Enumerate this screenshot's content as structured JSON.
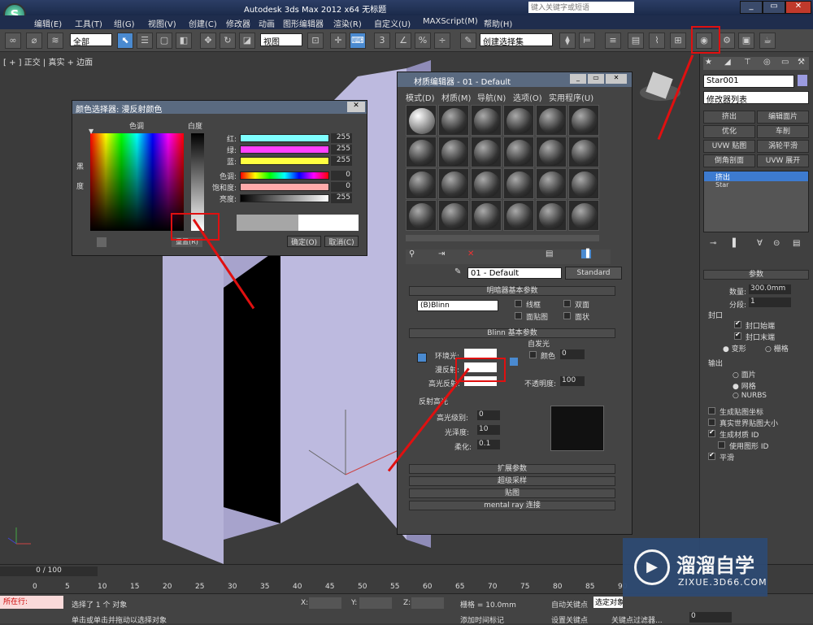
{
  "app": {
    "title": "Autodesk 3ds Max  2012 x64      无标题",
    "search_placeholder": "键入关键字或短语"
  },
  "menu": [
    "编辑(E)",
    "工具(T)",
    "组(G)",
    "视图(V)",
    "创建(C)",
    "修改器",
    "动画",
    "图形编辑器",
    "渲染(R)",
    "自定义(U)",
    "MAXScript(M)",
    "帮助(H)"
  ],
  "toolbar": {
    "filter": "全部",
    "view": "视图",
    "selection_set": "创建选择集"
  },
  "viewport": {
    "label": "[ + ] 正交 | 真实 + 边面"
  },
  "right_panel": {
    "object_name": "Star001",
    "modifier_list": "修改器列表",
    "buttons": [
      "挤出",
      "编辑面片",
      "优化",
      "车削",
      "UVW 贴图",
      "涡轮平滑",
      "倒角剖面",
      "UVW 展开"
    ],
    "stack": [
      "挤出",
      "Star"
    ],
    "params_title": "参数",
    "amount_label": "数量:",
    "amount_value": "300.0mm",
    "segments_label": "分段:",
    "segments_value": "1",
    "capping_title": "封口",
    "cap_start": "封口始端",
    "cap_end": "封口末端",
    "morph": "变形",
    "grid": "栅格",
    "output_title": "输出",
    "out_patch": "面片",
    "out_mesh": "网格",
    "out_nurbs": "NURBS",
    "gen_coords": "生成贴图坐标",
    "real_world": "真实世界贴图大小",
    "gen_mat_id": "生成材质 ID",
    "use_shape_id": "使用图形 ID",
    "smooth": "平滑"
  },
  "color_dialog": {
    "title": "颜色选择器: 漫反射颜色",
    "hue_label": "色调",
    "whiteness_label": "白度",
    "blackness_label": "黑度",
    "rows": [
      {
        "label": "红:",
        "value": "255",
        "color": "#7fffff"
      },
      {
        "label": "绿:",
        "value": "255",
        "color": "#ff40ff"
      },
      {
        "label": "蓝:",
        "value": "255",
        "color": "#ffff40"
      },
      {
        "label": "色调:",
        "value": "0",
        "color": "#ff0000"
      },
      {
        "label": "饱和度:",
        "value": "0",
        "color": "#ffaaaa"
      },
      {
        "label": "亮度:",
        "value": "255",
        "color": "#ffffff"
      }
    ],
    "reset": "重置(R)",
    "ok": "确定(O)",
    "cancel": "取消(C)"
  },
  "material_editor": {
    "title": "材质编辑器 - 01 - Default",
    "menu": [
      "模式(D)",
      "材质(M)",
      "导航(N)",
      "选项(O)",
      "实用程序(U)"
    ],
    "mat_name": "01 - Default",
    "mat_type": "Standard",
    "shader_title": "明暗器基本参数",
    "shader": "(B)Blinn",
    "wire": "线框",
    "two_sided": "双面",
    "face_map": "面贴图",
    "faceted": "面状",
    "blinn_title": "Blinn 基本参数",
    "self_illum": "自发光",
    "color": "颜色",
    "self_illum_value": "0",
    "ambient": "环境光:",
    "diffuse": "漫反射:",
    "specular": "高光反射:",
    "opacity": "不透明度:",
    "opacity_value": "100",
    "spec_title": "反射高光",
    "spec_level": "高光级别:",
    "spec_level_value": "0",
    "gloss": "光泽度:",
    "gloss_value": "10",
    "soften": "柔化:",
    "soften_value": "0.1",
    "rollouts": [
      "扩展参数",
      "超级采样",
      "贴图",
      "mental ray 连接"
    ]
  },
  "timeline": {
    "frame": "0 / 100",
    "ticks": [
      "0",
      "5",
      "10",
      "15",
      "20",
      "25",
      "30",
      "35",
      "40",
      "45",
      "50",
      "55",
      "60",
      "65",
      "70",
      "75",
      "80",
      "85",
      "90"
    ]
  },
  "status": {
    "selected": "选择了 1 个 对象",
    "hint": "单击或单击并拖动以选择对象",
    "in_progress": "所在行:",
    "grid": "栅格 = 10.0mm",
    "auto_key": "自动关键点",
    "set_key": "设置关键点",
    "selected_obj": "选定对象",
    "key_filter": "关键点过滤器...",
    "add_time_tag": "添加时间标记",
    "frame_value": "0",
    "x": "X:",
    "y": "Y:",
    "z": "Z:"
  },
  "watermark": {
    "brand": "溜溜自学",
    "url": "ZIXUE.3D66.COM"
  }
}
